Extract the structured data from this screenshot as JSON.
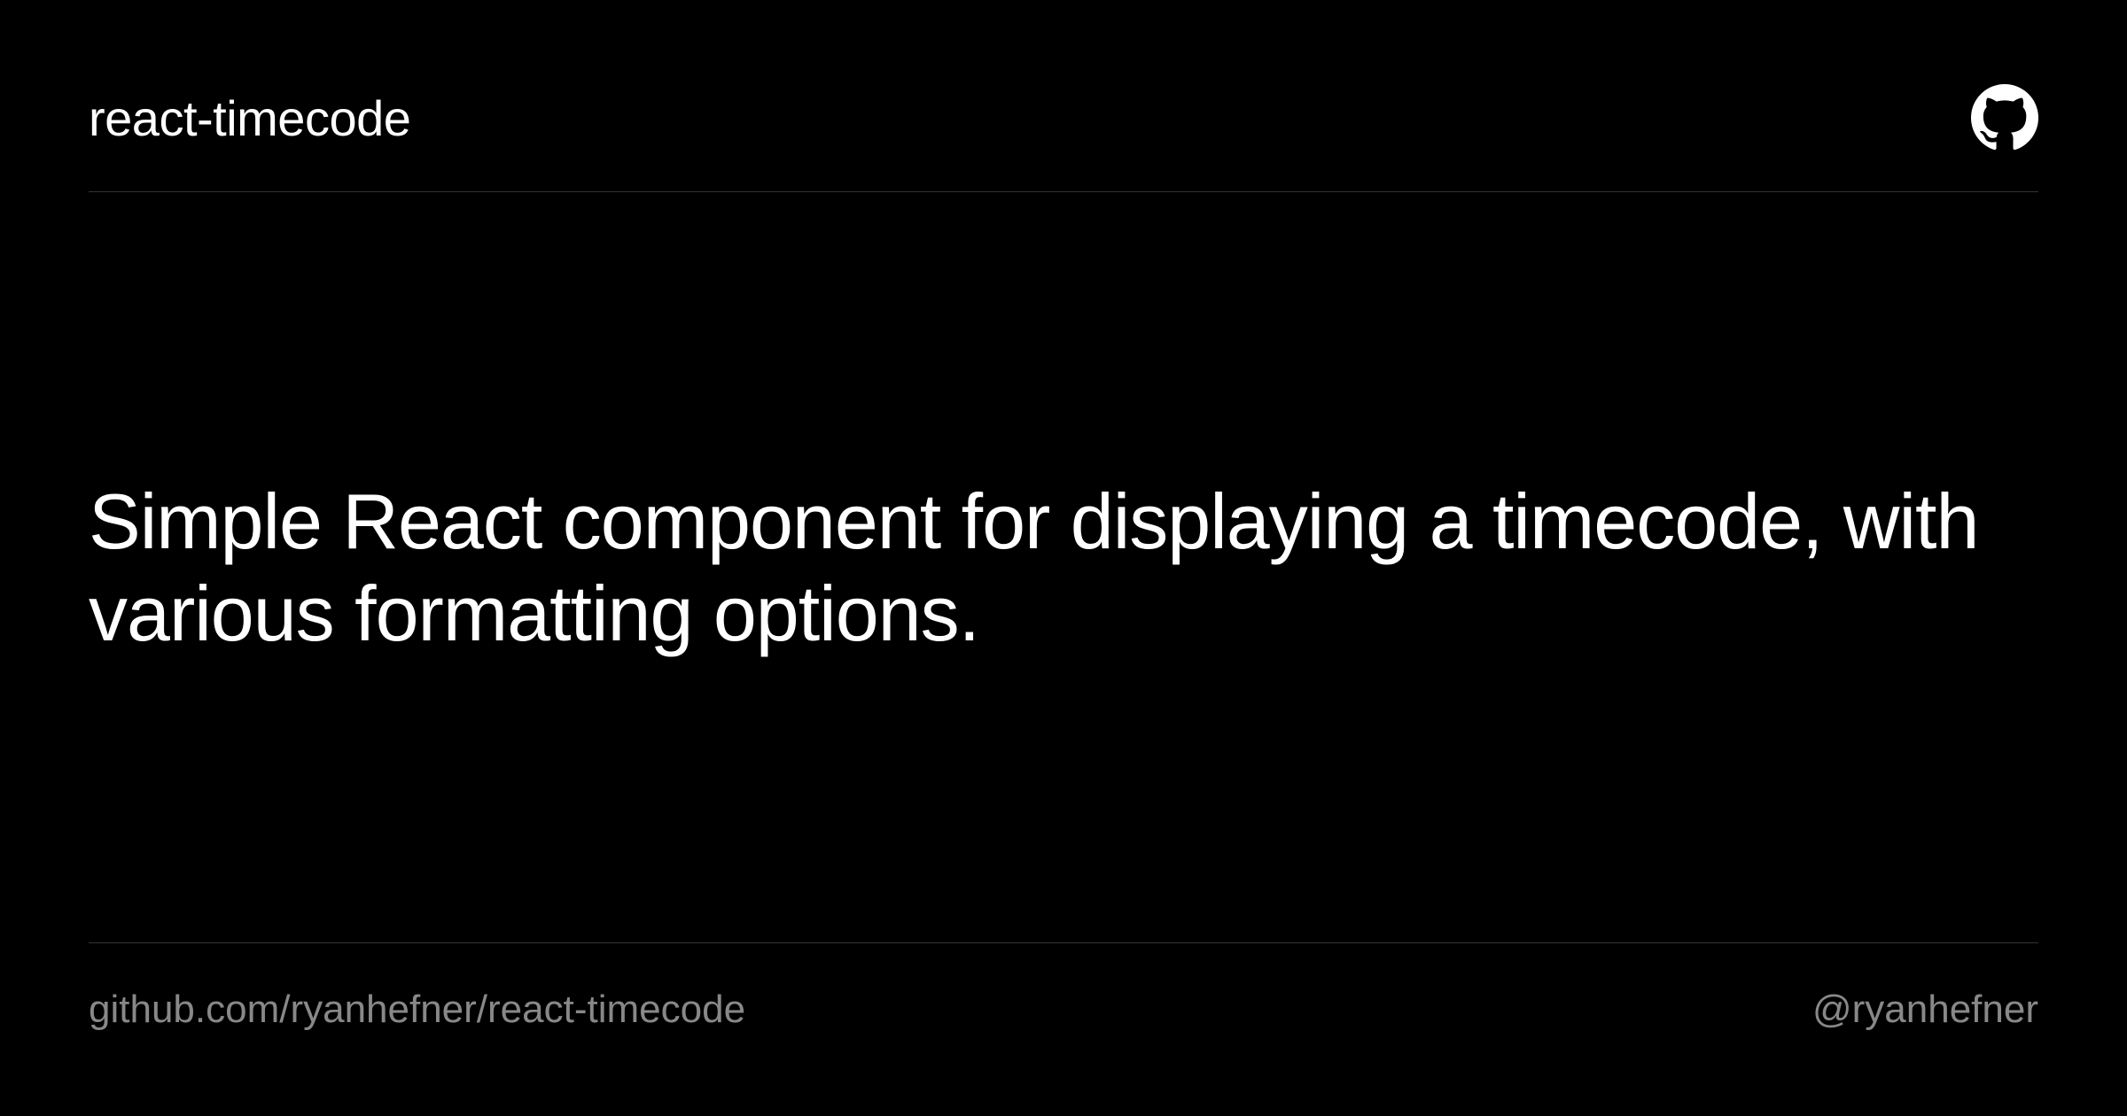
{
  "header": {
    "title": "react-timecode"
  },
  "main": {
    "description": "Simple React component for displaying a timecode, with various formatting options."
  },
  "footer": {
    "repo_url": "github.com/ryanhefner/react-timecode",
    "author_handle": "@ryanhefner"
  }
}
